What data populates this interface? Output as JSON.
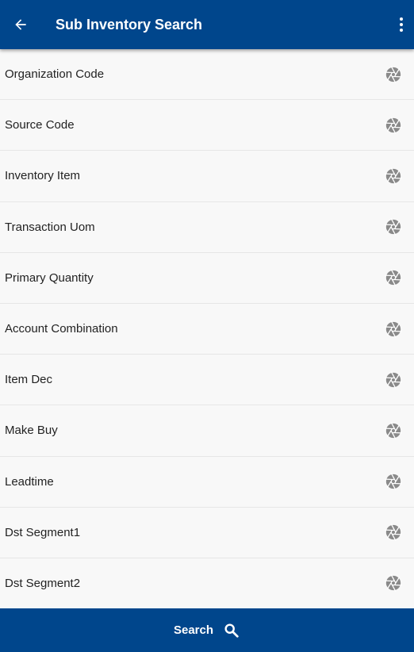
{
  "header": {
    "title": "Sub Inventory Search",
    "back_icon": "arrow-left-icon",
    "menu_icon": "more-vertical-icon"
  },
  "fields": [
    {
      "label": "Organization Code",
      "icon": "aperture-icon"
    },
    {
      "label": "Source Code",
      "icon": "aperture-icon"
    },
    {
      "label": "Inventory Item",
      "icon": "aperture-icon"
    },
    {
      "label": "Transaction Uom",
      "icon": "aperture-icon"
    },
    {
      "label": "Primary Quantity",
      "icon": "aperture-icon"
    },
    {
      "label": "Account Combination",
      "icon": "aperture-icon"
    },
    {
      "label": "Item Dec",
      "icon": "aperture-icon"
    },
    {
      "label": "Make Buy",
      "icon": "aperture-icon"
    },
    {
      "label": "Leadtime",
      "icon": "aperture-icon"
    },
    {
      "label": "Dst Segment1",
      "icon": "aperture-icon"
    },
    {
      "label": "Dst Segment2",
      "icon": "aperture-icon"
    }
  ],
  "footer": {
    "search_label": "Search",
    "search_icon": "search-icon"
  },
  "colors": {
    "primary": "#00468c",
    "background": "#f8f8f8",
    "icon_gray": "#8a8a8a"
  }
}
